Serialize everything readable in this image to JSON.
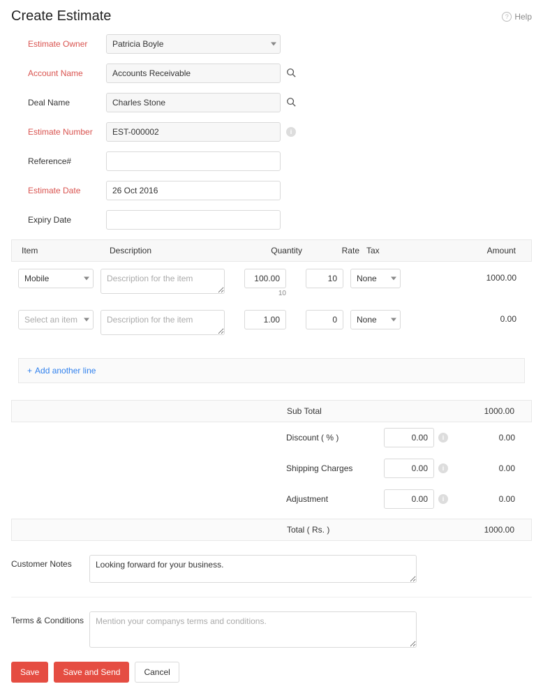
{
  "header": {
    "title": "Create Estimate",
    "help": "Help"
  },
  "form": {
    "estimate_owner": {
      "label": "Estimate Owner",
      "value": "Patricia Boyle"
    },
    "account_name": {
      "label": "Account Name",
      "value": "Accounts Receivable"
    },
    "deal_name": {
      "label": "Deal Name",
      "value": "Charles Stone"
    },
    "estimate_number": {
      "label": "Estimate Number",
      "value": "EST-000002"
    },
    "reference": {
      "label": "Reference#",
      "value": ""
    },
    "estimate_date": {
      "label": "Estimate Date",
      "value": "26 Oct 2016"
    },
    "expiry_date": {
      "label": "Expiry Date",
      "value": ""
    }
  },
  "items": {
    "headers": {
      "item": "Item",
      "desc": "Description",
      "qty": "Quantity",
      "rate": "Rate",
      "tax": "Tax",
      "amount": "Amount"
    },
    "desc_placeholder": "Description for the item",
    "select_placeholder": "Select an item",
    "rows": [
      {
        "item": "Mobile",
        "desc": "",
        "qty": "100.00",
        "qty_sub": "10",
        "rate": "10",
        "tax": "None",
        "amount": "1000.00"
      },
      {
        "item": "",
        "desc": "",
        "qty": "1.00",
        "qty_sub": "",
        "rate": "0",
        "tax": "None",
        "amount": "0.00"
      }
    ],
    "add_line": "Add another line"
  },
  "totals": {
    "sub_total": {
      "label": "Sub Total",
      "value": "1000.00"
    },
    "discount": {
      "label": "Discount ( % )",
      "input": "0.00",
      "value": "0.00"
    },
    "shipping": {
      "label": "Shipping Charges",
      "input": "0.00",
      "value": "0.00"
    },
    "adjustment": {
      "label": "Adjustment",
      "input": "0.00",
      "value": "0.00"
    },
    "total": {
      "label": "Total ( Rs. )",
      "value": "1000.00"
    }
  },
  "notes": {
    "customer_notes": {
      "label": "Customer Notes",
      "value": "Looking forward for your business."
    },
    "terms": {
      "label": "Terms & Conditions",
      "placeholder": "Mention your companys terms and conditions."
    }
  },
  "buttons": {
    "save": "Save",
    "save_send": "Save and Send",
    "cancel": "Cancel"
  }
}
